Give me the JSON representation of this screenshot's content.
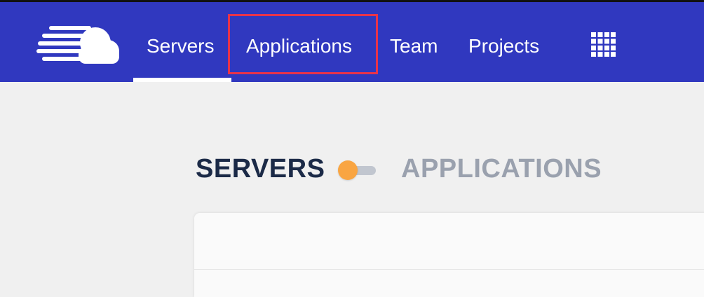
{
  "header": {
    "logo_icon": "cloudways-logo-icon",
    "nav": [
      {
        "label": "Servers",
        "active": true
      },
      {
        "label": "Applications",
        "highlighted": true
      },
      {
        "label": "Team"
      },
      {
        "label": "Projects"
      }
    ],
    "apps_grid_icon": "apps-grid-icon",
    "colors": {
      "background": "#3038bf",
      "text": "#ffffff",
      "highlight": "#e8334a"
    }
  },
  "view_toggle": {
    "left_label": "SERVERS",
    "right_label": "APPLICATIONS",
    "selected": "SERVERS",
    "colors": {
      "active_label": "#1b2a47",
      "inactive_label": "#9aa1ae",
      "knob": "#f9a542",
      "track": "#c1c6cf"
    }
  }
}
